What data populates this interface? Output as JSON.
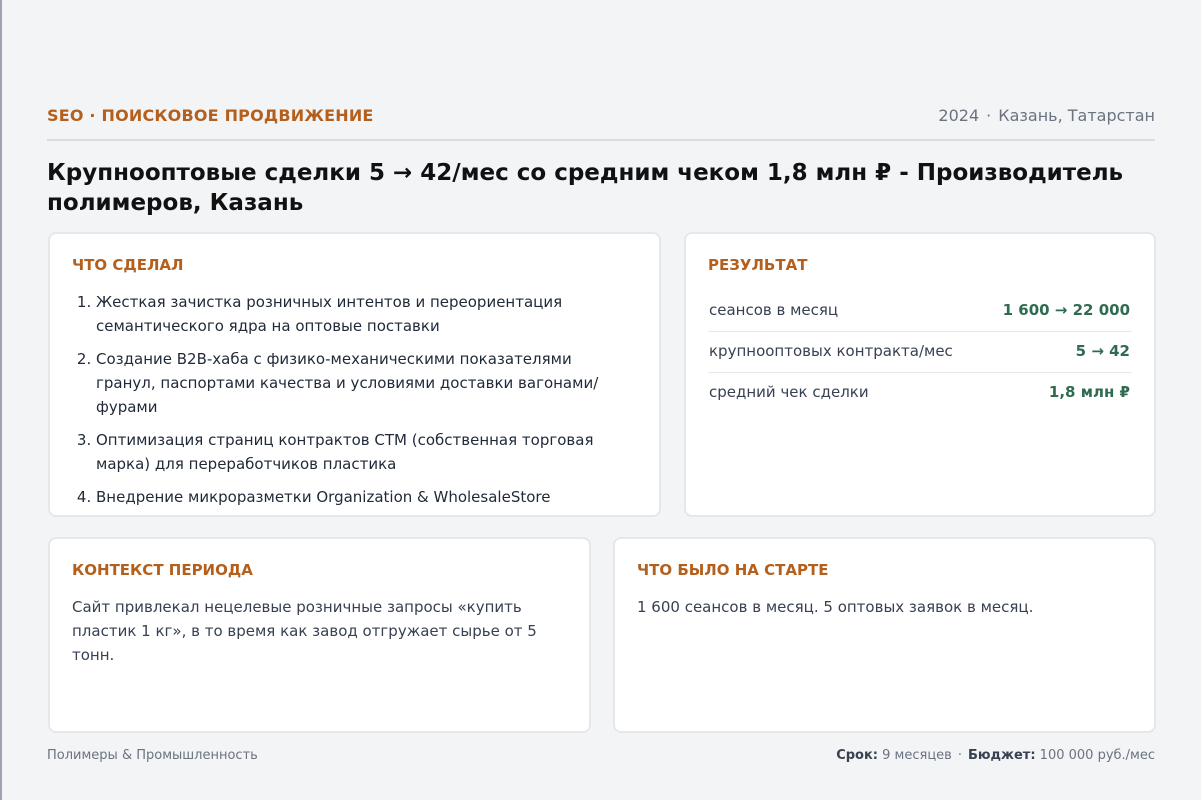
{
  "header": {
    "category": "SEO · ПОИСКОВОЕ ПРОДВИЖЕНИЕ",
    "year": "2024",
    "separator": "·",
    "location": "Казань, Татарстан"
  },
  "title": "Крупнооптовые сделки 5 → 42/мес со средним чеком 1,8 млн ₽ - Производитель полимеров, Казань",
  "done": {
    "heading": "ЧТО СДЕЛАЛ",
    "items": [
      "Жесткая зачистка розничных интентов и переориентация семантического ядра на оптовые поставки",
      "Создание B2B-хаба с физико-механическими показателями гранул, паспортами качества и условиями доставки вагонами/фурами",
      "Оптимизация страниц контрактов СТМ (собственная торговая марка) для переработчиков пластика",
      "Внедрение микроразметки Organization & WholesaleStore"
    ]
  },
  "result": {
    "heading": "РЕЗУЛЬТАТ",
    "metrics": [
      {
        "label": "сеансов в месяц",
        "value": "1 600 → 22 000"
      },
      {
        "label": "крупнооптовых контракта/мес",
        "value": "5 → 42"
      },
      {
        "label": "средний чек сделки",
        "value": "1,8 млн ₽"
      }
    ]
  },
  "context": {
    "heading": "КОНТЕКСТ ПЕРИОДА",
    "text": "Сайт привлекал нецелевые розничные запросы «купить пластик 1 кг», в то время как завод отгружает сырье от 5 тонн."
  },
  "start": {
    "heading": "ЧТО БЫЛО НА СТАРТЕ",
    "text": "1 600 сеансов в месяц. 5 оптовых заявок в месяц."
  },
  "footer": {
    "industry": "Полимеры & Промышленность",
    "term_label": "Срок:",
    "term_value": "9 месяцев",
    "separator": "·",
    "budget_label": "Бюджет:",
    "budget_value": "100 000 руб./мес"
  },
  "colors": {
    "accent": "#b45f1c",
    "metric_value": "#2f6b4f",
    "background": "#f3f4f6"
  }
}
